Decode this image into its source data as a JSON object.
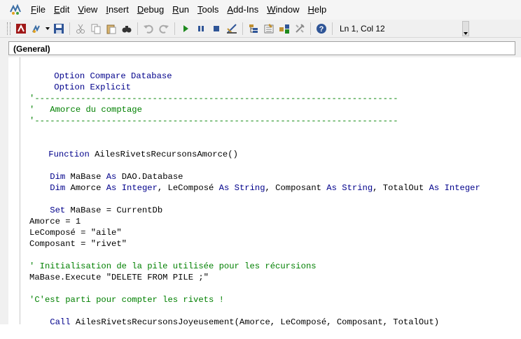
{
  "menu": {
    "items": [
      {
        "label": "File",
        "access": "F"
      },
      {
        "label": "Edit",
        "access": "E"
      },
      {
        "label": "View",
        "access": "V"
      },
      {
        "label": "Insert",
        "access": "I"
      },
      {
        "label": "Debug",
        "access": "D"
      },
      {
        "label": "Run",
        "access": "R"
      },
      {
        "label": "Tools",
        "access": "T"
      },
      {
        "label": "Add-Ins",
        "access": "A"
      },
      {
        "label": "Window",
        "access": "W"
      },
      {
        "label": "Help",
        "access": "H"
      }
    ]
  },
  "toolbar": {
    "icons": [
      "view-access-icon",
      "insert-module-icon",
      "save-icon",
      "cut-icon",
      "copy-icon",
      "paste-icon",
      "find-icon",
      "undo-icon",
      "redo-icon",
      "run-icon",
      "break-icon",
      "reset-icon",
      "design-mode-icon",
      "project-explorer-icon",
      "properties-icon",
      "object-browser-icon",
      "toolbox-icon",
      "help-icon"
    ],
    "position": "Ln 1, Col 12"
  },
  "object_combo": {
    "value": "(General)"
  },
  "colors": {
    "keyword": "#00008b",
    "comment": "#008000",
    "text": "#000000"
  },
  "code": {
    "l1": {
      "kw1": "Option",
      "t1": " ",
      "kw2": "Compare",
      "t2": " ",
      "kw3": "Database"
    },
    "l2": {
      "kw1": "Option",
      "t1": " ",
      "kw2": "Explicit"
    },
    "l3": "'-----------------------------------------------------------------------",
    "l4": "'   Amorce du comptage",
    "l5": "'-----------------------------------------------------------------------",
    "l6": {
      "kw1": "Function",
      "t1": " AilesRivetsRecursonsAmorce()"
    },
    "l7": {
      "kw1": "Dim",
      "t1": " MaBase ",
      "kw2": "As",
      "t2": " DAO.Database"
    },
    "l8": {
      "kw1": "Dim",
      "t1": " Amorce ",
      "kw2": "As",
      "t2": " ",
      "kw3": "Integer",
      "t3": ", LeComposé ",
      "kw4": "As",
      "t4": " ",
      "kw5": "String",
      "t5": ", Composant ",
      "kw6": "As",
      "t6": " ",
      "kw7": "String",
      "t7": ", TotalOut ",
      "kw8": "As",
      "t8": " ",
      "kw9": "Integer"
    },
    "l9": {
      "kw1": "Set",
      "t1": " MaBase = CurrentDb"
    },
    "l10": "Amorce = 1",
    "l11": "LeComposé = \"aile\"",
    "l12": "Composant = \"rivet\"",
    "l13": "' Initialisation de la pile utilisée pour les récursions",
    "l14": "MaBase.Execute \"DELETE FROM PILE ;\"",
    "l15": "'C'est parti pour compter les rivets !",
    "l16": {
      "kw1": "Call",
      "t1": " AilesRivetsRecursonsJoyeusement(Amorce, LeComposé, Composant, TotalOut)"
    }
  }
}
